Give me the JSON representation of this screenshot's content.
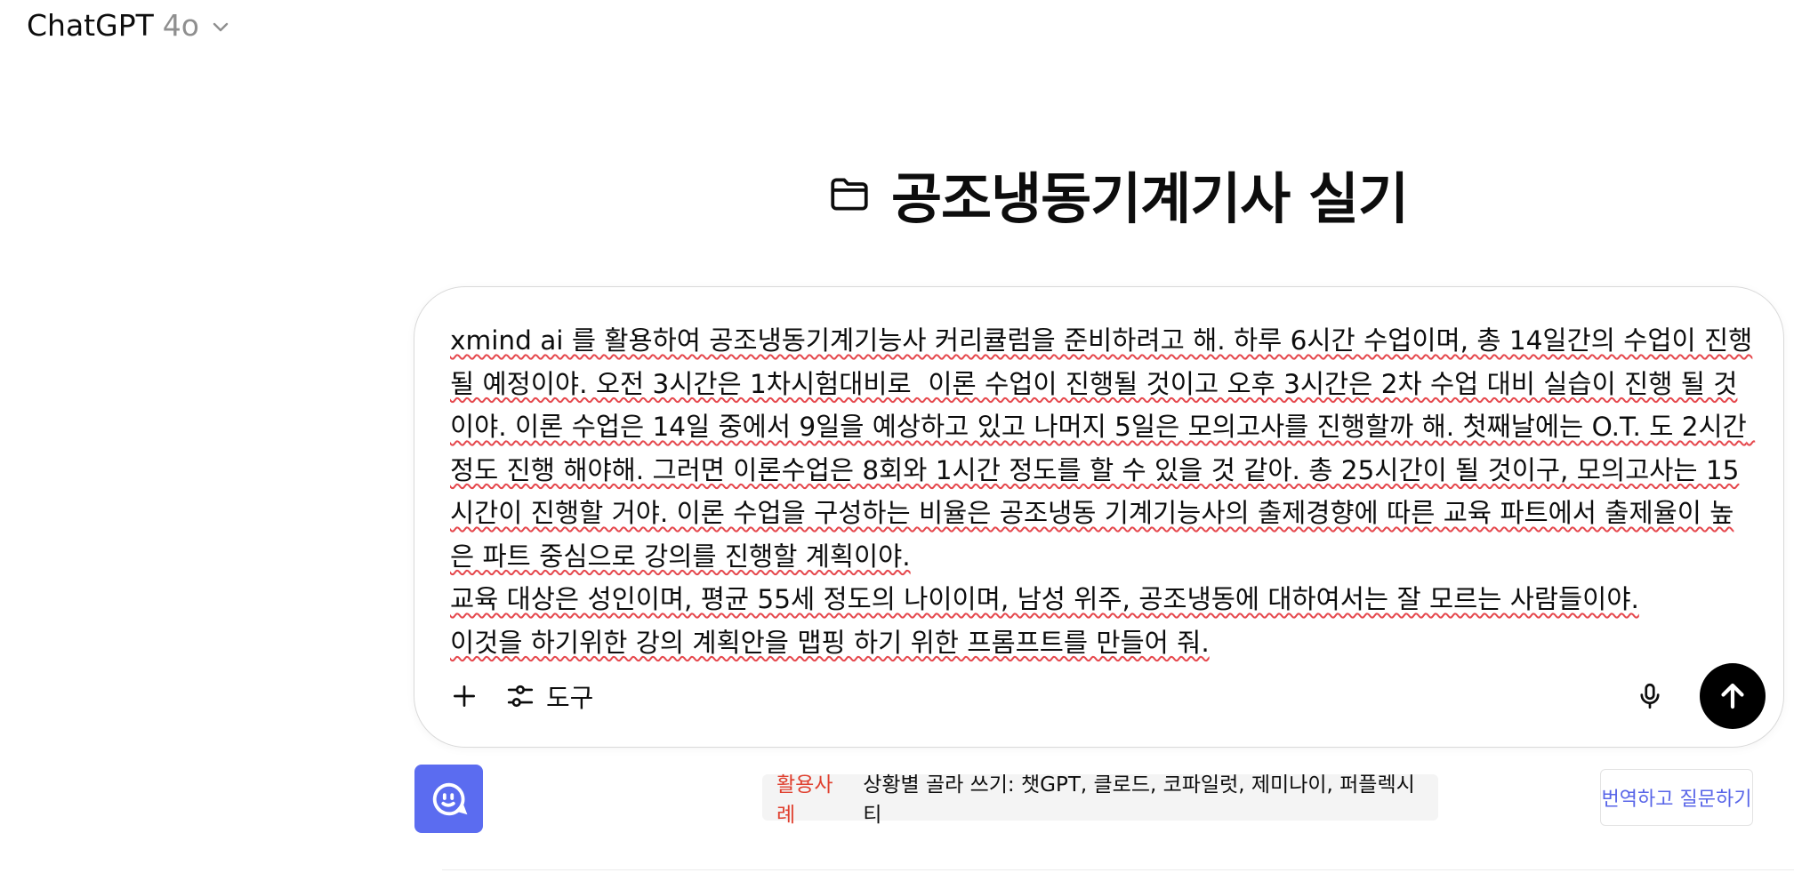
{
  "header": {
    "model_name": "ChatGPT",
    "model_version": "4o"
  },
  "project": {
    "title": "공조냉동기계기사 실기",
    "icon": "folder-icon"
  },
  "composer": {
    "prompt_paragraphs": [
      "xmind ai 를 활용하여 공조냉동기계기능사 커리큘럼을 준비하려고 해. 하루 6시간 수업이며, 총 14일간의 수업이 진행될 예정이야. 오전 3시간은 1차시험대비로  이론 수업이 진행될 것이고 오후 3시간은 2차 수업 대비 실습이 진행 될 것이야. 이론 수업은 14일 중에서 9일을 예상하고 있고 나머지 5일은 모의고사를 진행할까 해. 첫째날에는 O.T. 도 2시간 정도 진행 해야해. 그러면 이론수업은 8회와 1시간 정도를 할 수 있을 것 같아. 총 25시간이 될 것이구, 모의고사는 15시간이 진행할 거야. 이론 수업을 구성하는 비율은 공조냉동 기계기능사의 출제경향에 따른 교육 파트에서 출제율이 높은 파트 중심으로 강의를 진행할 계획이야.",
      "교육 대상은 성인이며, 평균 55세 정도의 나이이며, 남성 위주, 공조냉동에 대하여서는 잘 모르는 사람들이야.",
      "이것을 하기위한 강의 계획안을 맵핑 하기 위한 프롬프트를 만들어 줘."
    ],
    "tools_label": "도구",
    "icons": {
      "add": "plus-icon",
      "tools": "sliders-icon",
      "mic": "microphone-icon",
      "send": "arrow-up-icon"
    },
    "send_button_color": "#000000"
  },
  "extension": {
    "bot_icon": "chat-bubble-smile-icon",
    "bot_color": "#5b6cf0",
    "usecase_tag": "활용사례",
    "usecase_text": "상황별 골라 쓰기: 챗GPT, 클로드, 코파일럿, 제미나이, 퍼플렉시티",
    "usecase_tag_color": "#e0402f",
    "translate_label": "번역하고 질문하기",
    "translate_color": "#5865e8"
  }
}
